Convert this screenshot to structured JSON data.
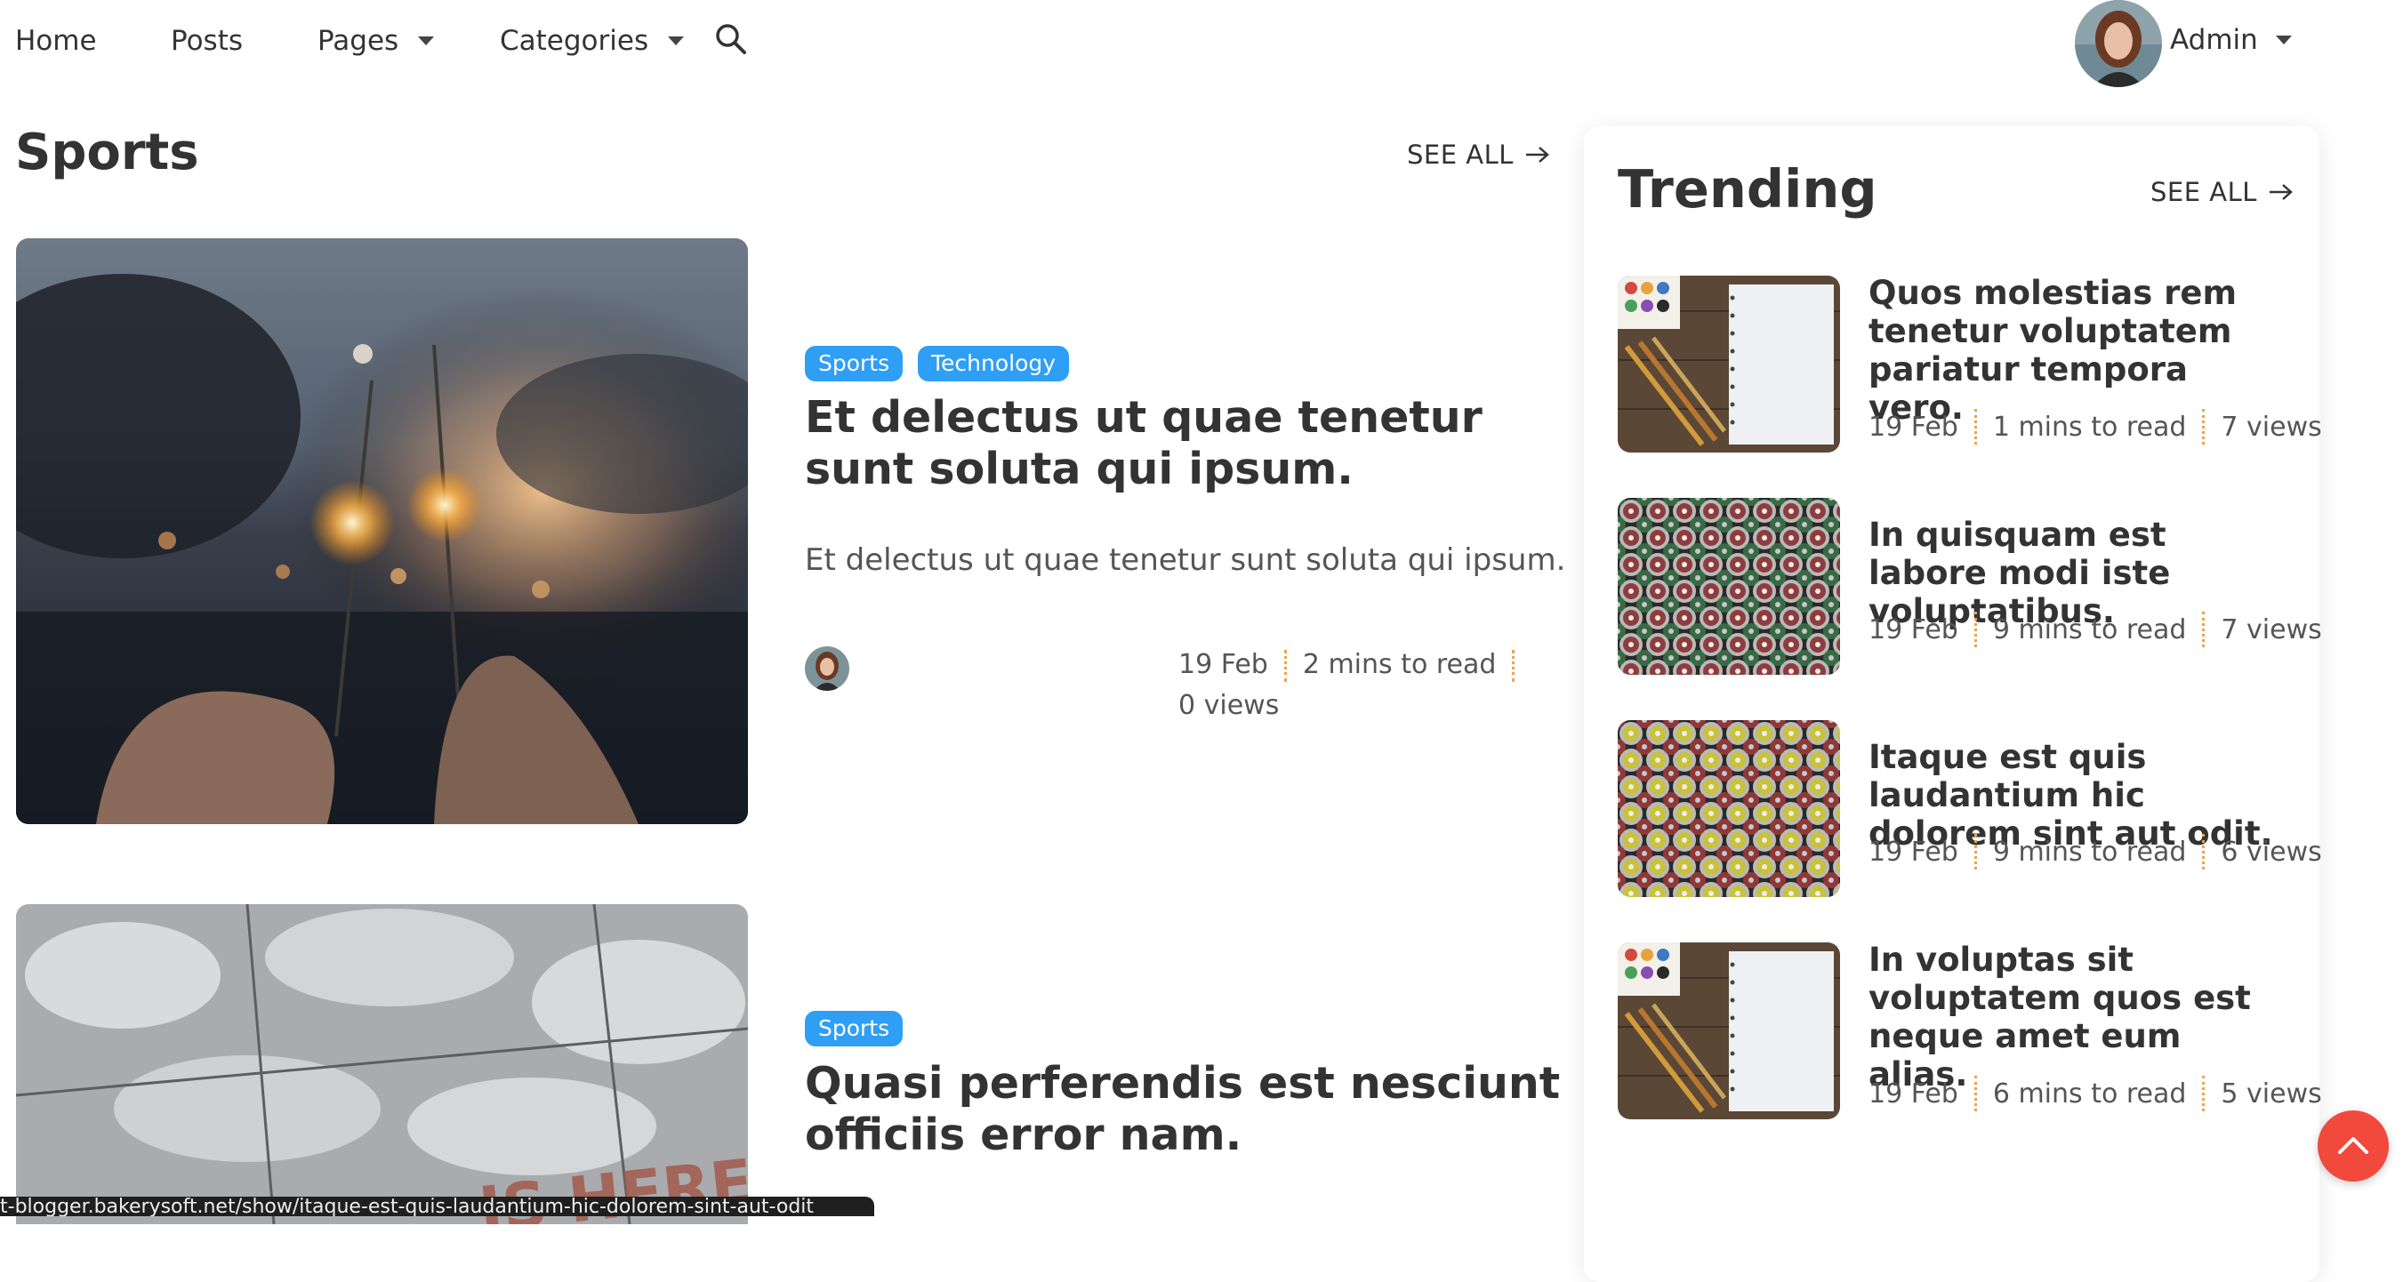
{
  "nav": {
    "items": [
      {
        "label": "Home"
      },
      {
        "label": "Posts"
      },
      {
        "label": "Pages"
      },
      {
        "label": "Categories"
      }
    ],
    "user_label": "Admin"
  },
  "section": {
    "title": "Sports",
    "see_all": "SEE ALL"
  },
  "posts": [
    {
      "badges": [
        "Sports",
        "Technology"
      ],
      "title": "Et delectus ut quae tenetur sunt soluta qui ipsum.",
      "excerpt": "Et delectus ut quae tenetur sunt soluta qui ipsum.",
      "date": "19 Feb",
      "read_time": "2 mins to read",
      "views": "0 views"
    },
    {
      "badges": [
        "Sports"
      ],
      "title": "Quasi perferendis est nesciunt officiis error nam."
    }
  ],
  "trending": {
    "title": "Trending",
    "see_all": "SEE ALL",
    "items": [
      {
        "title": "Quos molestias rem tenetur voluptatem pariatur tempora vero.",
        "date": "19 Feb",
        "read_time": "1 mins to read",
        "views": "7 views",
        "thumb": "notebook"
      },
      {
        "title": "In quisquam est labore modi iste voluptatibus.",
        "date": "19 Feb",
        "read_time": "9 mins to read",
        "views": "7 views",
        "thumb": "spray-cans"
      },
      {
        "title": "Itaque est quis laudantium hic dolorem sint aut odit.",
        "date": "19 Feb",
        "read_time": "9 mins to read",
        "views": "6 views",
        "thumb": "spray-cans"
      },
      {
        "title": "In voluptas sit voluptatem quos est neque amet eum alias.",
        "date": "19 Feb",
        "read_time": "6 mins to read",
        "views": "5 views",
        "thumb": "notebook"
      }
    ]
  },
  "status_bar": {
    "url": "t-blogger.bakerysoft.net/show/itaque-est-quis-laudantium-hic-dolorem-sint-aut-odit"
  },
  "colors": {
    "badge": "#2f9ef5",
    "separator": "#e9a44c",
    "scroll_top": "#f2493d"
  }
}
